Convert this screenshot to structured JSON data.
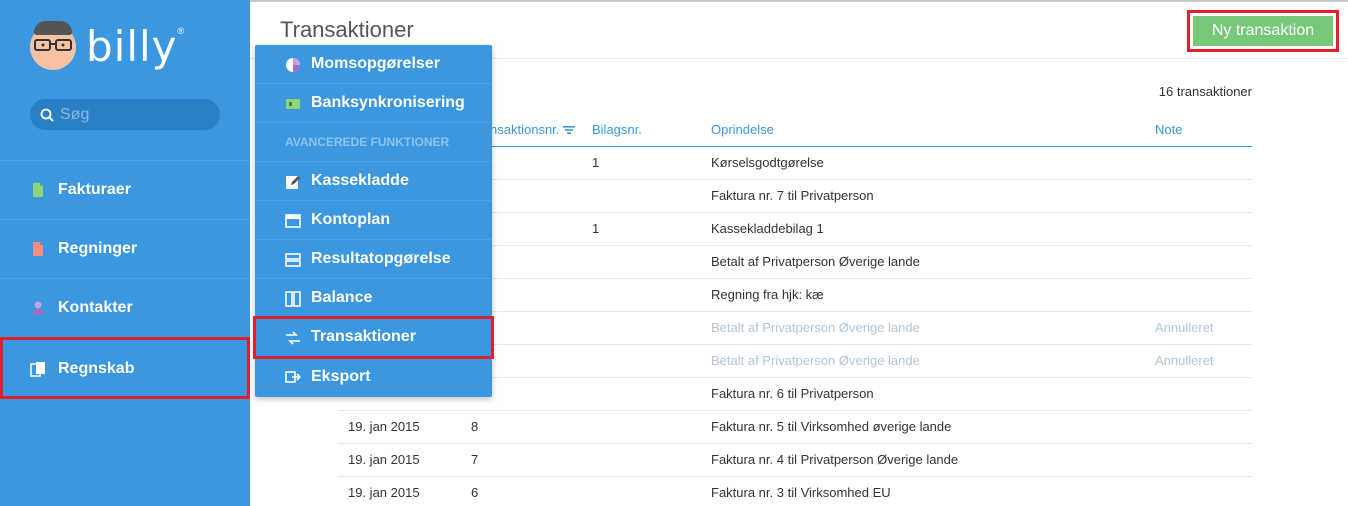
{
  "app": {
    "logo_text": "billy",
    "logo_reg": "®"
  },
  "search": {
    "placeholder": "Søg"
  },
  "sidebar": {
    "items": [
      {
        "label": "Fakturaer",
        "icon": "invoice-icon"
      },
      {
        "label": "Regninger",
        "icon": "bill-icon"
      },
      {
        "label": "Kontakter",
        "icon": "contact-icon"
      },
      {
        "label": "Regnskab",
        "icon": "accounting-icon"
      }
    ]
  },
  "header": {
    "title": "Transaktioner",
    "new_button": "Ny transaktion"
  },
  "table": {
    "count": "16 transaktioner",
    "columns": [
      "Transaktionsnr.",
      "Bilagsnr.",
      "Oprindelse",
      "Note"
    ],
    "rows": [
      {
        "date": "",
        "nr": "",
        "bilag": "1",
        "origin": "Kørselsgodtgørelse",
        "note": ""
      },
      {
        "date": "",
        "nr": "",
        "bilag": "",
        "origin": "Faktura nr. 7 til Privatperson",
        "note": ""
      },
      {
        "date": "",
        "nr": "",
        "bilag": "1",
        "origin": "Kassekladdebilag 1",
        "note": ""
      },
      {
        "date": "",
        "nr": "",
        "bilag": "",
        "origin": "Betalt af Privatperson Øverige lande",
        "note": ""
      },
      {
        "date": "",
        "nr": "",
        "bilag": "",
        "origin": "Regning fra hjk: kæ",
        "note": ""
      },
      {
        "date": "",
        "nr": "",
        "bilag": "",
        "origin": "Betalt af Privatperson Øverige lande",
        "note": "Annulleret"
      },
      {
        "date": "",
        "nr": "",
        "bilag": "",
        "origin": "Betalt af Privatperson Øverige lande",
        "note": "Annulleret"
      },
      {
        "date": "",
        "nr": "",
        "bilag": "",
        "origin": "Faktura nr. 6 til Privatperson",
        "note": ""
      },
      {
        "date": "19. jan 2015",
        "nr": "8",
        "bilag": "",
        "origin": "Faktura nr. 5 til Virksomhed øverige lande",
        "note": ""
      },
      {
        "date": "19. jan 2015",
        "nr": "7",
        "bilag": "",
        "origin": "Faktura nr. 4 til Privatperson Øverige lande",
        "note": ""
      },
      {
        "date": "19. jan 2015",
        "nr": "6",
        "bilag": "",
        "origin": "Faktura nr. 3 til Virksomhed EU",
        "note": ""
      }
    ]
  },
  "dropdown": {
    "items_top": [
      {
        "label": "Momsopgørelser",
        "icon": "pie-chart-icon"
      },
      {
        "label": "Banksynkronisering",
        "icon": "bank-sync-icon"
      }
    ],
    "section_header": "AVANCEREDE FUNKTIONER",
    "items_advanced": [
      {
        "label": "Kassekladde",
        "icon": "edit-icon"
      },
      {
        "label": "Kontoplan",
        "icon": "chart-of-accounts-icon"
      },
      {
        "label": "Resultatopgørelse",
        "icon": "income-statement-icon"
      },
      {
        "label": "Balance",
        "icon": "balance-icon"
      },
      {
        "label": "Transaktioner",
        "icon": "transactions-icon"
      },
      {
        "label": "Eksport",
        "icon": "export-icon"
      }
    ]
  },
  "colors": {
    "brand_blue": "#3a97e0",
    "primary_button": "#78c87a",
    "highlight_red": "#e0202c"
  }
}
